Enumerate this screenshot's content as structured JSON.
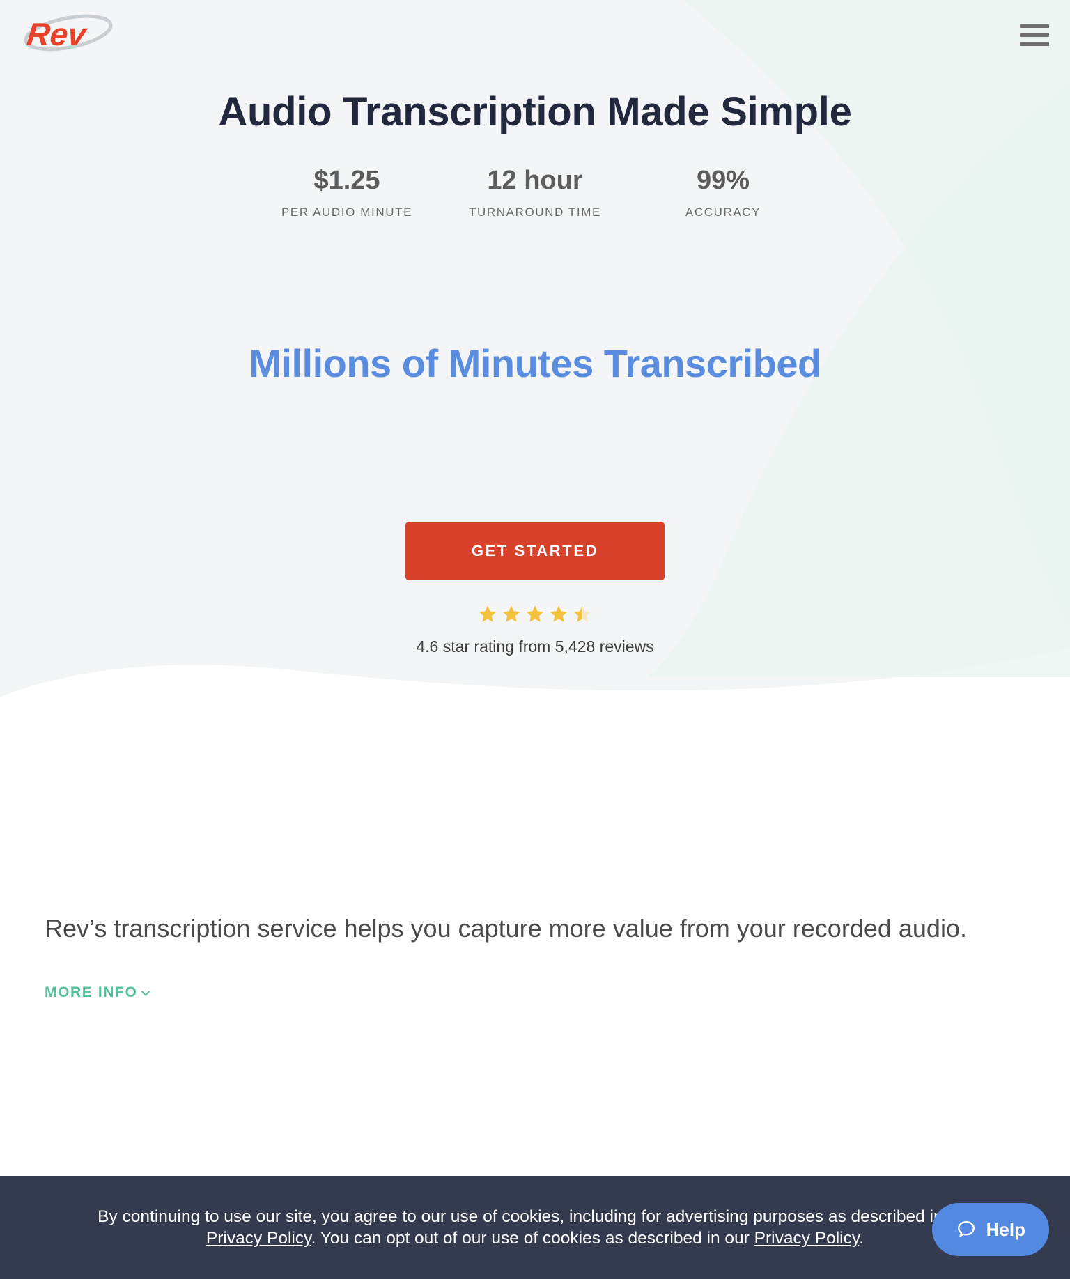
{
  "header": {
    "logo_text": "Rev",
    "logo_name": "rev-logo",
    "menu_icon": "hamburger-menu-icon"
  },
  "hero": {
    "title": "Audio Transcription Made Simple",
    "stats": [
      {
        "value": "$1.25",
        "label": "PER AUDIO MINUTE"
      },
      {
        "value": "12 hour",
        "label": "TURNAROUND TIME"
      },
      {
        "value": "99%",
        "label": "ACCURACY"
      }
    ],
    "subtitle": "Millions of Minutes Transcribed",
    "subtitle_color": "#5a8de0",
    "cta_label": "GET STARTED",
    "cta_color": "#d8412a",
    "rating": {
      "stars_filled": 4,
      "stars_half": 1,
      "stars_total": 5,
      "star_color": "#f2c23e",
      "text": "4.6 star rating from 5,428 reviews",
      "score": "4.6",
      "review_count": "5,428"
    }
  },
  "description": {
    "paragraph": "Rev’s transcription service helps you capture more value from your recorded audio.",
    "more_info_label": "MORE INFO",
    "more_info_color": "#53c29b",
    "chevron_icon": "chevron-down-icon"
  },
  "cookie_banner": {
    "part1": "By continuing to use our site, you agree to our use of cookies, including for advertising purposes as described in our ",
    "link1": "Privacy Policy",
    "part2": ". You can opt out of our use of cookies as described in our ",
    "link2": "Privacy Policy",
    "part3": ".",
    "background": "#343b4f"
  },
  "help_widget": {
    "label": "Help",
    "icon": "chat-bubble-icon",
    "background": "#5389e0"
  },
  "theme": {
    "hero_background": "#f4f5f6",
    "hero_accent_background": "#eaf4f0",
    "page_background": "#ffffff",
    "heading_color": "#22293f",
    "stat_color": "#5c5c5c"
  }
}
